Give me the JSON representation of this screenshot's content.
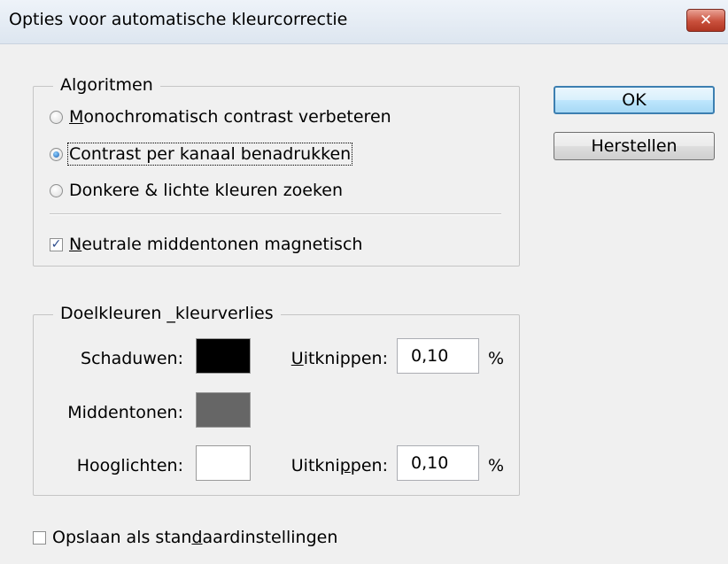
{
  "window": {
    "title": "Opties voor automatische kleurcorrectie",
    "close_label": "✕"
  },
  "algorithms": {
    "legend": "Algoritmen",
    "options": [
      {
        "label": "Monochromatisch contrast verbeteren",
        "mnemonic": "M",
        "rest": "onochromatisch contrast verbeteren",
        "selected": false
      },
      {
        "label": "Contrast per kanaal benadrukken",
        "mnemonic": "",
        "rest": "Contrast per kanaal benadrukken",
        "selected": true
      },
      {
        "label": "Donkere & lichte kleuren zoeken",
        "mnemonic": "",
        "rest": "Donkere & lichte kleuren zoeken",
        "selected": false
      }
    ],
    "snap_neutral": {
      "label": "Neutrale middentonen magnetisch",
      "mnemonic": "N",
      "rest": "eutrale middentonen magnetisch",
      "checked": true
    }
  },
  "target_colors": {
    "legend": "Doelkleuren _kleurverlies",
    "shadows": {
      "label": "Schaduwen:",
      "color": "#000000",
      "clip_label_pre": "",
      "clip_mnemonic": "U",
      "clip_label_post": "itknippen:",
      "clip_value": "0,10",
      "unit": "%"
    },
    "midtones": {
      "label": "Middentonen:",
      "color": "#666666"
    },
    "highlights": {
      "label": "Hooglichten:",
      "color": "#ffffff",
      "clip_label_pre": "Uitkni",
      "clip_mnemonic": "p",
      "clip_label_post": "pen:",
      "clip_value": "0,10",
      "unit": "%"
    }
  },
  "buttons": {
    "ok": "OK",
    "reset": "Herstellen"
  },
  "save_defaults": {
    "pre": "Opslaan als stan",
    "mnemonic": "d",
    "post": "aardinstellingen",
    "checked": false
  }
}
